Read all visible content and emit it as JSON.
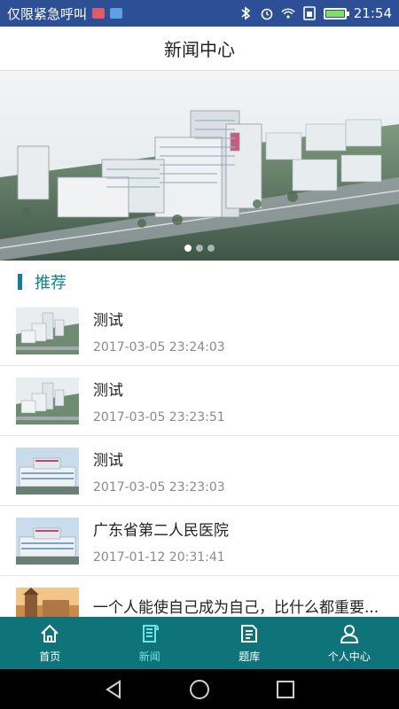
{
  "status_bar": {
    "carrier_text": "仅限紧急呼叫",
    "time": "21:54",
    "battery_level": 0.9,
    "icons": [
      "bluetooth-icon",
      "alarm-icon",
      "wifi-icon",
      "sim-icon",
      "battery-icon"
    ]
  },
  "header": {
    "title": "新闻中心"
  },
  "banner": {
    "slide_count": 3,
    "active_index": 0
  },
  "section": {
    "title": "推荐"
  },
  "news": [
    {
      "title": "测试",
      "date": "2017-03-05 23:24:03",
      "thumb": "aerial"
    },
    {
      "title": "测试",
      "date": "2017-03-05 23:23:51",
      "thumb": "aerial"
    },
    {
      "title": "测试",
      "date": "2017-03-05 23:23:03",
      "thumb": "front"
    },
    {
      "title": "广东省第二人民医院",
      "date": "2017-01-12 20:31:41",
      "thumb": "front"
    },
    {
      "title": "一个人能使自己成为自己，比什么都重要...",
      "date": "",
      "thumb": "castle"
    }
  ],
  "bottom_nav": {
    "items": [
      {
        "label": "首页",
        "icon": "home-icon",
        "active": false
      },
      {
        "label": "新闻",
        "icon": "news-icon",
        "active": true
      },
      {
        "label": "题库",
        "icon": "question-bank-icon",
        "active": false
      },
      {
        "label": "个人中心",
        "icon": "profile-icon",
        "active": false
      }
    ]
  },
  "colors": {
    "status_bar": "#2d4f95",
    "accent": "#12808e",
    "nav_bg": "#0f7479",
    "nav_active": "#6fe3e8"
  }
}
